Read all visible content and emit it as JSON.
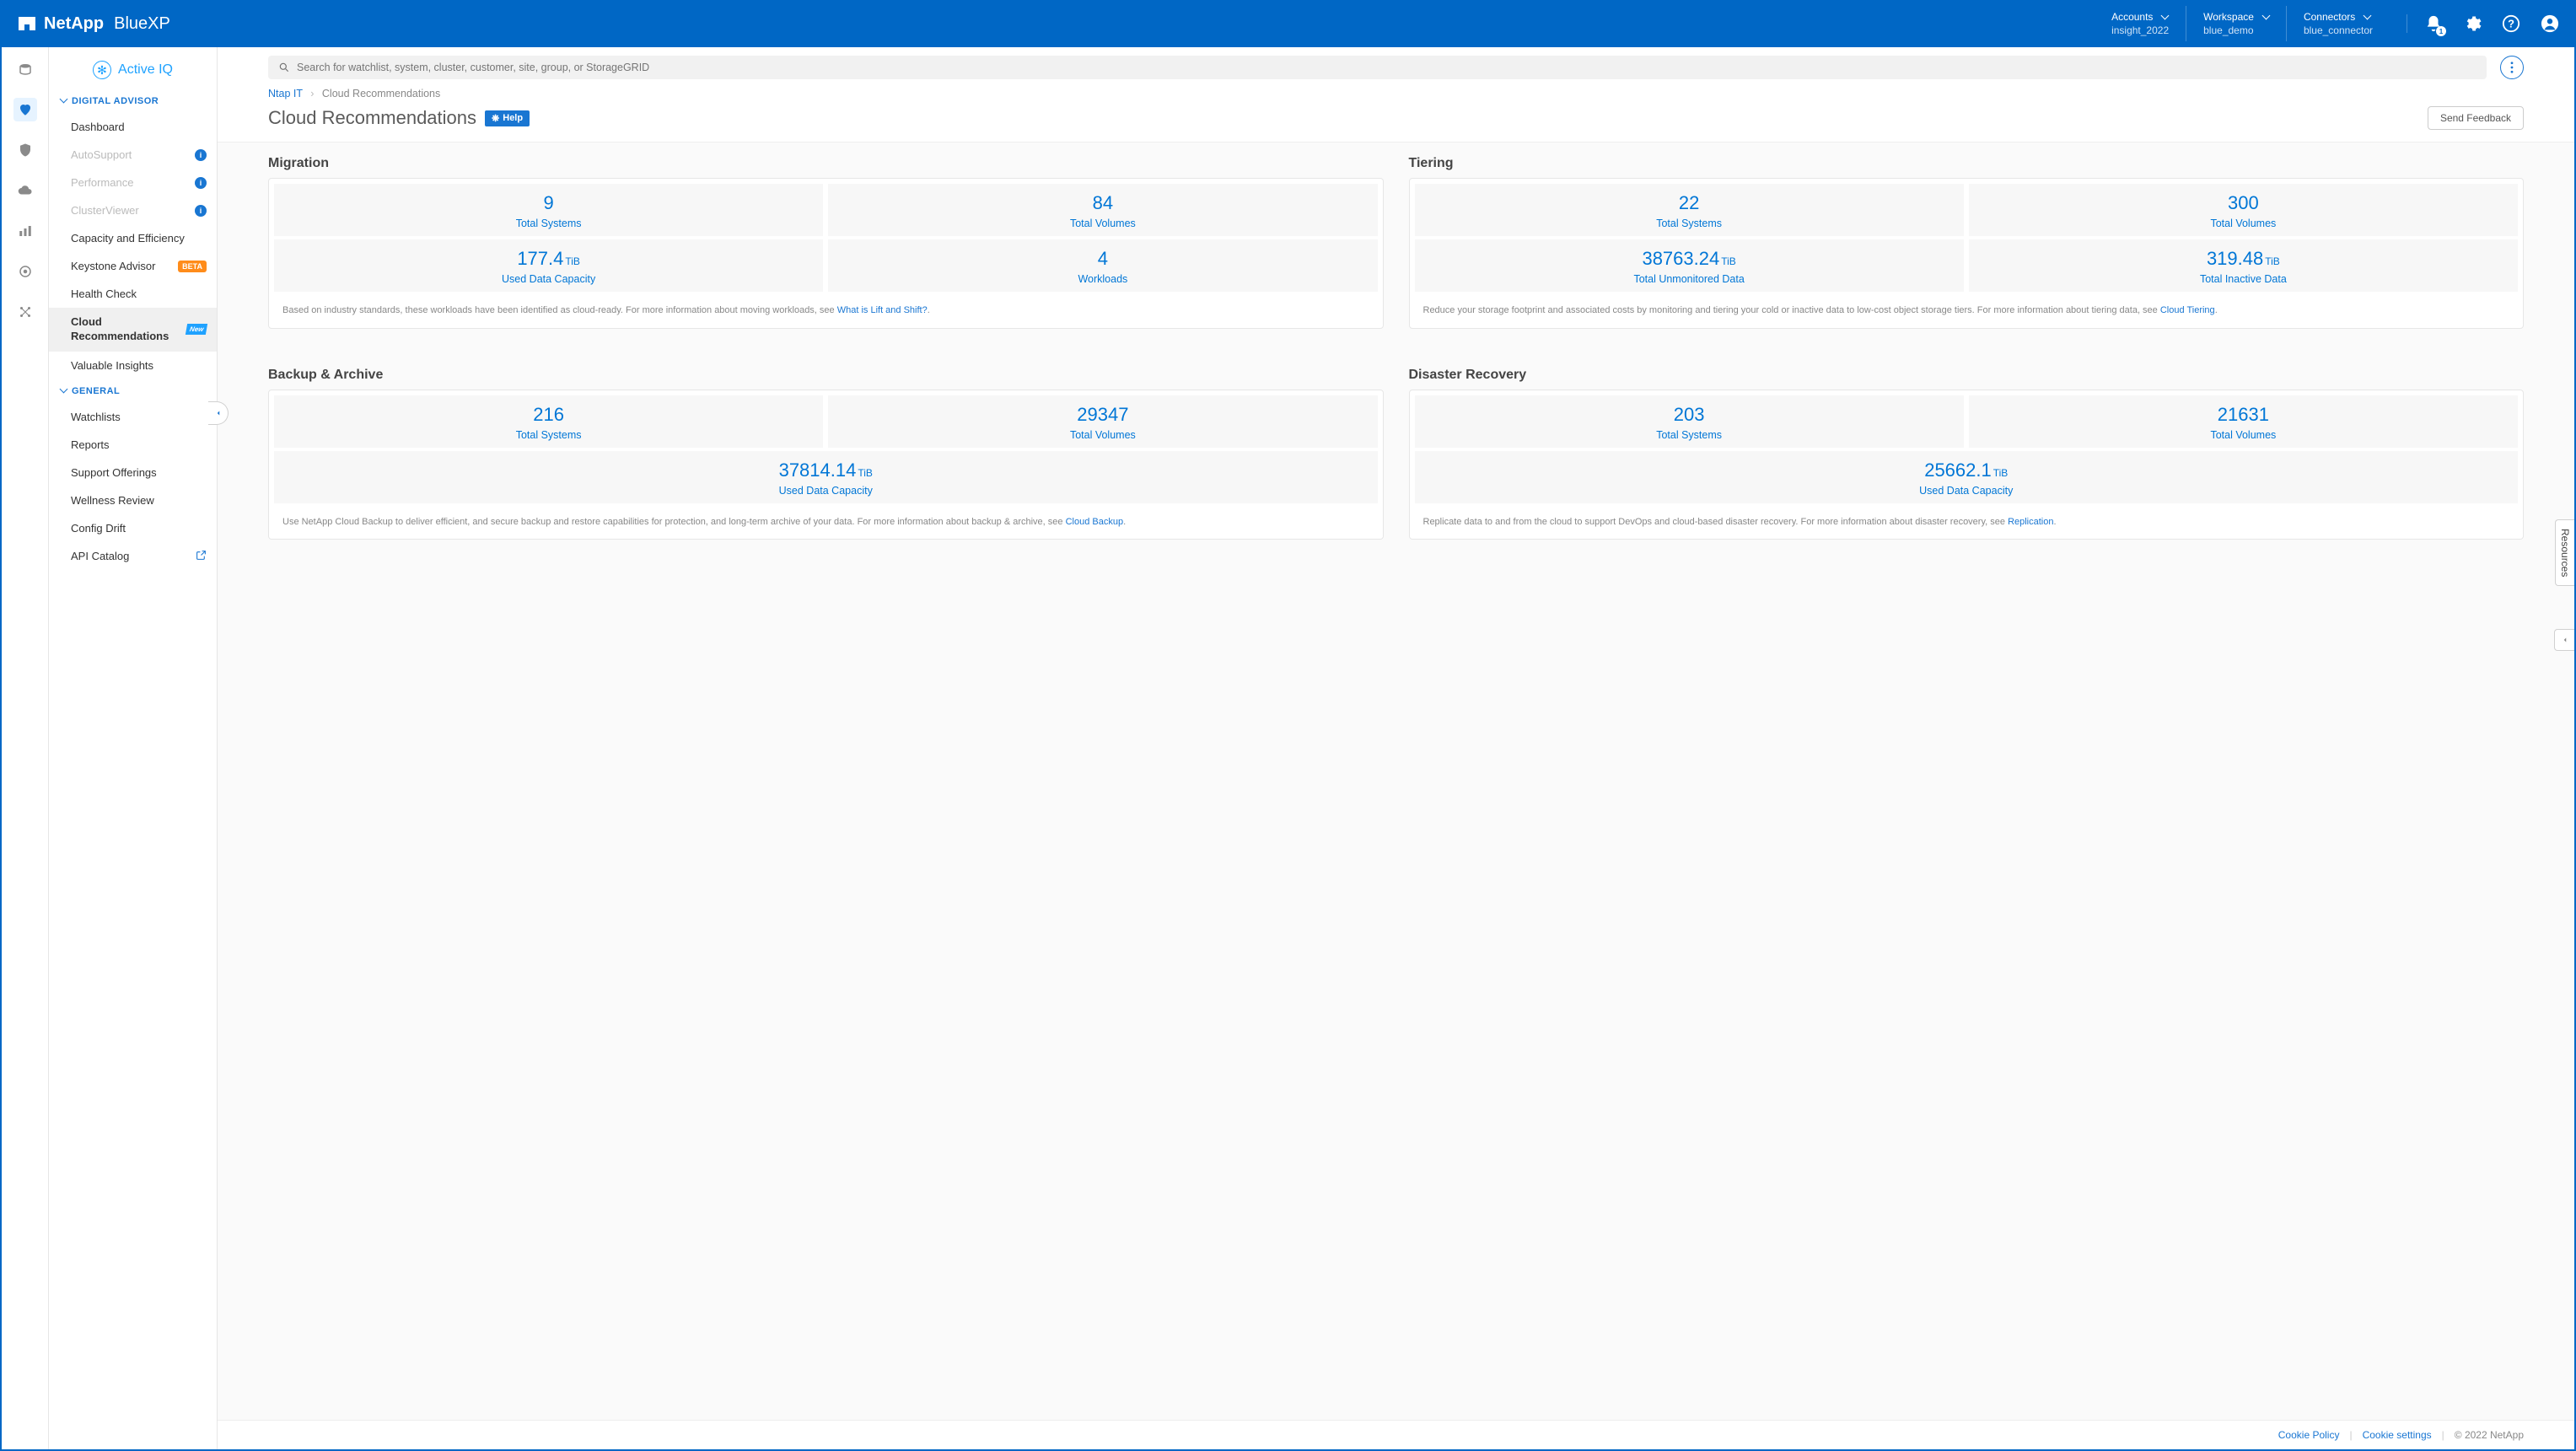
{
  "header": {
    "brand": "NetApp",
    "product": "BlueXP",
    "selectors": [
      {
        "label": "Accounts",
        "value": "insight_2022"
      },
      {
        "label": "Workspace",
        "value": "blue_demo"
      },
      {
        "label": "Connectors",
        "value": "blue_connector"
      }
    ],
    "notif_count": "1"
  },
  "sidebar": {
    "brand": "Active IQ",
    "sections": {
      "digital_advisor": {
        "header": "DIGITAL ADVISOR",
        "items": [
          {
            "label": "Dashboard",
            "badge": null
          },
          {
            "label": "AutoSupport",
            "badge": "info",
            "greyed": true
          },
          {
            "label": "Performance",
            "badge": "info",
            "greyed": true
          },
          {
            "label": "ClusterViewer",
            "badge": "info",
            "greyed": true
          },
          {
            "label": "Capacity and Efficiency",
            "badge": null
          },
          {
            "label": "Keystone Advisor",
            "badge": "BETA"
          },
          {
            "label": "Health Check",
            "badge": null
          },
          {
            "label": "Cloud Recommendations",
            "badge": "New",
            "active": true
          },
          {
            "label": "Valuable Insights",
            "badge": null
          }
        ]
      },
      "general": {
        "header": "GENERAL",
        "items": [
          {
            "label": "Watchlists"
          },
          {
            "label": "Reports"
          },
          {
            "label": "Support Offerings"
          },
          {
            "label": "Wellness Review"
          },
          {
            "label": "Config Drift"
          },
          {
            "label": "API Catalog",
            "ext": true
          }
        ]
      }
    }
  },
  "search": {
    "placeholder": "Search for watchlist, system, cluster, customer, site, group, or StorageGRID"
  },
  "breadcrumb": {
    "root": "Ntap IT",
    "current": "Cloud Recommendations"
  },
  "page": {
    "title": "Cloud Recommendations",
    "help": "Help",
    "feedback": "Send Feedback"
  },
  "cards": {
    "migration": {
      "title": "Migration",
      "stats": [
        [
          {
            "value": "9",
            "unit": "",
            "label": "Total Systems"
          },
          {
            "value": "84",
            "unit": "",
            "label": "Total Volumes"
          }
        ],
        [
          {
            "value": "177.4",
            "unit": "TiB",
            "label": "Used Data Capacity"
          },
          {
            "value": "4",
            "unit": "",
            "label": "Workloads"
          }
        ]
      ],
      "footer_text": "Based on industry standards, these workloads have been identified as cloud-ready. For more information about moving workloads, see ",
      "footer_link": "What is Lift and Shift?",
      "footer_after": "."
    },
    "tiering": {
      "title": "Tiering",
      "stats": [
        [
          {
            "value": "22",
            "unit": "",
            "label": "Total Systems"
          },
          {
            "value": "300",
            "unit": "",
            "label": "Total Volumes"
          }
        ],
        [
          {
            "value": "38763.24",
            "unit": "TiB",
            "label": "Total Unmonitored Data"
          },
          {
            "value": "319.48",
            "unit": "TiB",
            "label": "Total Inactive Data"
          }
        ]
      ],
      "footer_text": "Reduce your storage footprint and associated costs by monitoring and tiering your cold or inactive data to low-cost object storage tiers. For more information about tiering data, see ",
      "footer_link": "Cloud Tiering",
      "footer_after": "."
    },
    "backup": {
      "title": "Backup & Archive",
      "stats": [
        [
          {
            "value": "216",
            "unit": "",
            "label": "Total Systems"
          },
          {
            "value": "29347",
            "unit": "",
            "label": "Total Volumes"
          }
        ],
        [
          {
            "value": "37814.14",
            "unit": "TiB",
            "label": "Used Data Capacity"
          }
        ]
      ],
      "footer_text": "Use NetApp Cloud Backup to deliver efficient, and secure backup and restore capabilities for protection, and long-term archive of your data. For more information about backup & archive, see ",
      "footer_link": "Cloud Backup",
      "footer_after": "."
    },
    "dr": {
      "title": "Disaster Recovery",
      "stats": [
        [
          {
            "value": "203",
            "unit": "",
            "label": "Total Systems"
          },
          {
            "value": "21631",
            "unit": "",
            "label": "Total Volumes"
          }
        ],
        [
          {
            "value": "25662.1",
            "unit": "TiB",
            "label": "Used Data Capacity"
          }
        ]
      ],
      "footer_text": "Replicate data to and from the cloud to support DevOps and cloud-based disaster recovery. For more information about disaster recovery, see ",
      "footer_link": "Replication",
      "footer_after": "."
    }
  },
  "footer": {
    "cookie_policy": "Cookie Policy",
    "cookie_settings": "Cookie settings",
    "copyright": "© 2022 NetApp"
  },
  "resources": {
    "label": "Resources"
  }
}
